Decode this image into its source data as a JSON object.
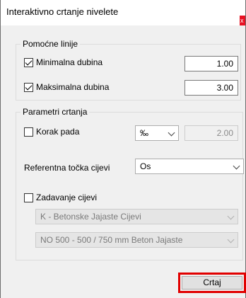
{
  "window": {
    "title": "Interaktivno crtanje nivelete",
    "close_glyph": "x"
  },
  "group_pomocne": {
    "legend": "Pomoćne linije",
    "min_depth": {
      "label": "Minimalna dubina",
      "checked": true,
      "value": "1.00"
    },
    "max_depth": {
      "label": "Maksimalna dubina",
      "checked": true,
      "value": "3.00"
    }
  },
  "group_parametri": {
    "legend": "Parametri crtanja",
    "korak_pada": {
      "label": "Korak pada",
      "checked": false,
      "unit": "‰",
      "value": "2.00"
    },
    "referentna": {
      "label": "Referentna točka cijevi",
      "selected": "Os"
    },
    "zadavanje": {
      "label": "Zadavanje cijevi",
      "checked": false
    },
    "pipe_type": "K - Betonske Jajaste Cijevi",
    "pipe_size": "NO 500 - 500 / 750 mm Beton Jajaste"
  },
  "buttons": {
    "draw_label": "Crtaj"
  },
  "colors": {
    "highlight": "#e10000",
    "close": "#e81123"
  }
}
